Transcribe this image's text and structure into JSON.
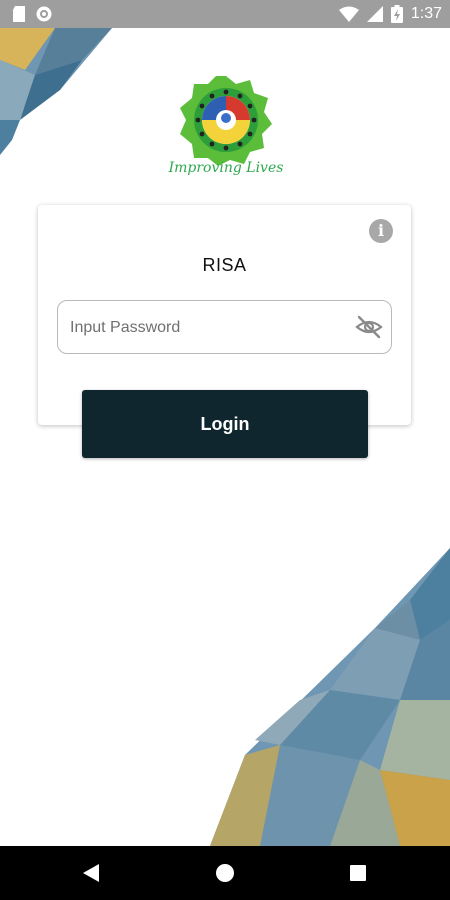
{
  "status_bar": {
    "time": "1:37",
    "icons": [
      "sd-card-icon",
      "notification-icon",
      "wifi-icon",
      "signal-icon",
      "battery-charging-icon"
    ]
  },
  "logo": {
    "tagline": "Improving Lives"
  },
  "login_card": {
    "title": "RISA",
    "password_placeholder": "Input Password",
    "password_value": "",
    "info_icon": "info-icon",
    "visibility_icon": "eye-off-icon"
  },
  "login_button": {
    "label": "Login"
  },
  "nav_bar": {
    "icons": [
      "back-icon",
      "home-icon",
      "recents-icon"
    ]
  },
  "colors": {
    "button_bg": "#10262f",
    "status_bar_bg": "#9e9e9e",
    "decor_blue": "#5f8aa6",
    "decor_gold": "#c9a24a"
  }
}
